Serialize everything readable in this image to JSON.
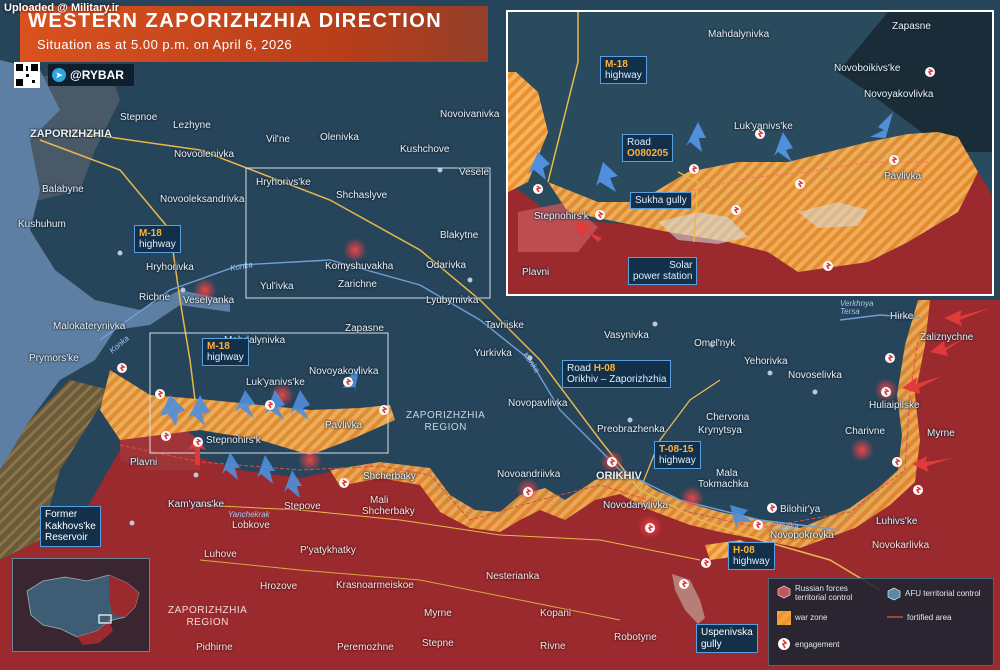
{
  "header": {
    "title": "WESTERN ZAPORIZHZHIA DIRECTION",
    "subtitle": "Situation as at 5.00 p.m. on April 6, 2026",
    "watermark": "Uploaded @ Military.ir",
    "brand": "@RYBAR",
    "brand_icon": "telegram-icon",
    "qr_icon": "qr-code-icon"
  },
  "colors": {
    "russian_control": "#9b2a2e",
    "afu_control": "#26445a",
    "war_zone": "#f29a2e",
    "fortified_line": "#e04b4b",
    "engagement": "#ff3b3b",
    "water": "#5d7fa3",
    "roads": "#e8b84a"
  },
  "places_main": [
    {
      "name": "Stepnoe",
      "dark": false
    },
    {
      "name": "Lezhyne",
      "dark": false
    },
    {
      "name": "Vil'ne",
      "dark": false
    },
    {
      "name": "Olenivka",
      "dark": false
    },
    {
      "name": "Novoivanivka",
      "dark": false
    },
    {
      "name": "ZAPORIZHZHIA",
      "dark": false
    },
    {
      "name": "Novoolenivka",
      "dark": false
    },
    {
      "name": "Kushchove",
      "dark": false
    },
    {
      "name": "Vesele",
      "dark": false
    },
    {
      "name": "Hryhorivs'ke",
      "dark": false
    },
    {
      "name": "Balabyne",
      "dark": false
    },
    {
      "name": "Novooleksandrivka",
      "dark": false
    },
    {
      "name": "Shchaslyve",
      "dark": false
    },
    {
      "name": "Kushuhum",
      "dark": false
    },
    {
      "name": "Blakytne",
      "dark": false
    },
    {
      "name": "Hryhorivka",
      "dark": false
    },
    {
      "name": "Komyshuvakha",
      "dark": false
    },
    {
      "name": "Odarivka",
      "dark": false
    },
    {
      "name": "Yul'ivka",
      "dark": false
    },
    {
      "name": "Zarichne",
      "dark": false
    },
    {
      "name": "Richne",
      "dark": false
    },
    {
      "name": "Veselyanka",
      "dark": false
    },
    {
      "name": "Lyubymivka",
      "dark": false
    },
    {
      "name": "Tavriiske",
      "dark": false
    },
    {
      "name": "Malokaterynivka",
      "dark": false
    },
    {
      "name": "Zapasne",
      "dark": false
    },
    {
      "name": "Mahdalynivka",
      "dark": false
    },
    {
      "name": "Vasynivka",
      "dark": false
    },
    {
      "name": "Omel'nyk",
      "dark": false
    },
    {
      "name": "Yurkivka",
      "dark": false
    },
    {
      "name": "Yehorivka",
      "dark": false
    },
    {
      "name": "Prymors'ke",
      "dark": false
    },
    {
      "name": "Novoyakovlivka",
      "dark": false
    },
    {
      "name": "Novoselivka",
      "dark": false
    },
    {
      "name": "Luk'yanivs'ke",
      "dark": false
    },
    {
      "name": "Huliaipilske",
      "dark": false
    },
    {
      "name": "Novopavlivka",
      "dark": false
    },
    {
      "name": "Pavlivka",
      "dark": false
    },
    {
      "name": "Stepnohirs'k",
      "dark": false
    },
    {
      "name": "Preobrazhenka",
      "dark": false
    },
    {
      "name": "Chervona",
      "dark": false
    },
    {
      "name": "Krynytsya",
      "dark": false
    },
    {
      "name": "Charivne",
      "dark": false
    },
    {
      "name": "Myrne",
      "dark": false
    },
    {
      "name": "Plavni",
      "dark": false
    },
    {
      "name": "Shcherbaky",
      "dark": false
    },
    {
      "name": "Novoandriivka",
      "dark": false
    },
    {
      "name": "ORIKHIV",
      "dark": false
    },
    {
      "name": "Mala",
      "dark": false
    },
    {
      "name": "Tokmachka",
      "dark": false
    },
    {
      "name": "Mali",
      "dark": true
    },
    {
      "name": "Shcherbaky",
      "dark": true
    },
    {
      "name": "Kam'yans'ke",
      "dark": false
    },
    {
      "name": "Stepove",
      "dark": true
    },
    {
      "name": "Novodanylivka",
      "dark": false
    },
    {
      "name": "Bilohir'ya",
      "dark": false
    },
    {
      "name": "Luhivs'ke",
      "dark": false
    },
    {
      "name": "Lobkove",
      "dark": true
    },
    {
      "name": "Novopokrovka",
      "dark": false
    },
    {
      "name": "Novokarlivka",
      "dark": true
    },
    {
      "name": "Luhove",
      "dark": true
    },
    {
      "name": "P'yatykhatky",
      "dark": true
    },
    {
      "name": "Nesterianka",
      "dark": true
    },
    {
      "name": "Hrozove",
      "dark": true
    },
    {
      "name": "Krasnoarmeiskoe",
      "dark": true
    },
    {
      "name": "Myrne",
      "dark": true
    },
    {
      "name": "Kopani",
      "dark": true
    },
    {
      "name": "Pidhirne",
      "dark": true
    },
    {
      "name": "Peremozhne",
      "dark": true
    },
    {
      "name": "Stepne",
      "dark": true
    },
    {
      "name": "Rivne",
      "dark": true
    },
    {
      "name": "Robotyne",
      "dark": true
    },
    {
      "name": "Hirke",
      "dark": false
    },
    {
      "name": "Zaliznychne",
      "dark": false
    }
  ],
  "regions": {
    "zap_north": "ZAPORIZHZHIA\nREGION",
    "zap_south": "ZAPORIZHZHIA\nREGION"
  },
  "roads": {
    "m18_main": {
      "code": "M-18",
      "text": "highway"
    },
    "m18_second": {
      "code": "M-18",
      "text": "highway"
    },
    "h08": {
      "prefix": "Road",
      "code": "H-08",
      "text": "Orikhiv – Zaporizhzhia"
    },
    "t0815": {
      "code": "T-08-15",
      "text": "highway"
    },
    "h08_south": {
      "code": "H-08",
      "text": "highway"
    }
  },
  "rivers": [
    "Konka",
    "Konka",
    "Yanchekrak",
    "Konka",
    "Konka",
    "Verkhnya Tersa"
  ],
  "callouts": {
    "reservoir": "Former\nKakhovs'ke\nReservoir",
    "uspenivska": "Uspenivska\ngully"
  },
  "inset": {
    "places": [
      "Zapasne",
      "Mahdalynivka",
      "Novoboikivs'ke",
      "Novoyakovlivka",
      "Luk'yanivs'ke",
      "Pavlivka",
      "Stepnohirs'k",
      "Plavni"
    ],
    "m18": {
      "code": "M-18",
      "text": "highway"
    },
    "road": {
      "prefix": "Road",
      "code": "O080205"
    },
    "sukha": "Sukha gully",
    "solar": "Solar\npower station"
  },
  "legend": {
    "russian": "Russian forces\nterritorial control",
    "afu": "AFU territorial control",
    "warzone": "war zone",
    "fortified": "fortified area",
    "engagement": "engagement"
  }
}
